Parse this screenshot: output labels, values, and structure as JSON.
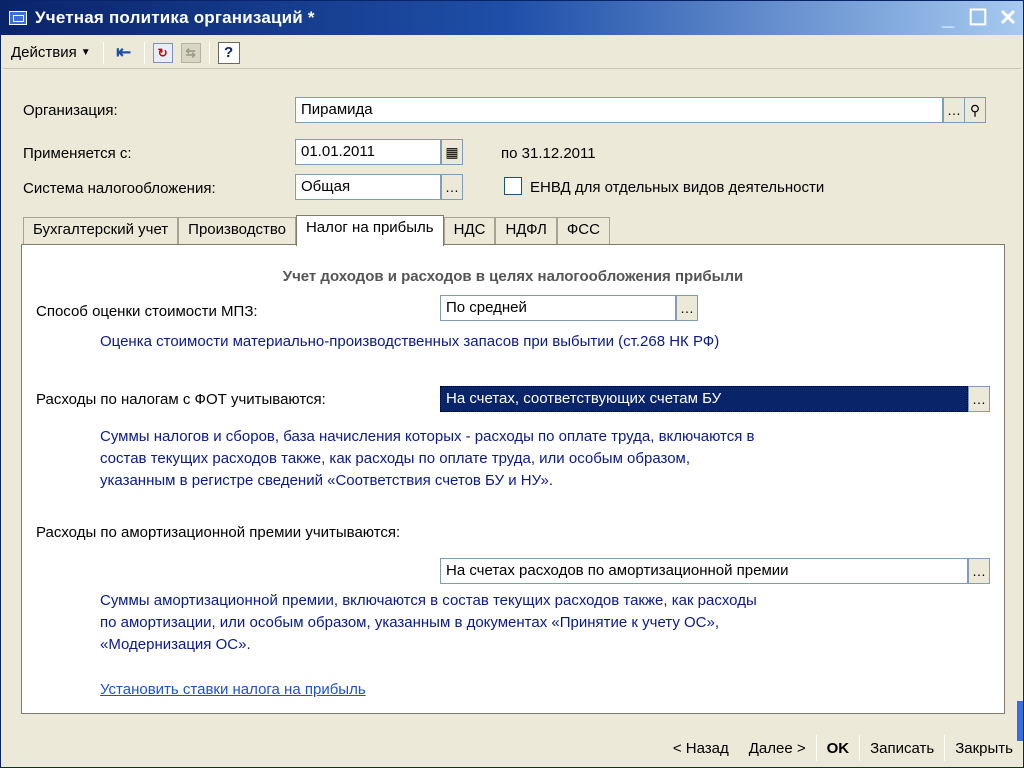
{
  "window": {
    "title": "Учетная политика организаций *",
    "controls": [
      "_",
      "☐",
      "✕"
    ]
  },
  "toolbar": {
    "actions_label": "Действия",
    "help_label": "?"
  },
  "form": {
    "organization_label": "Организация:",
    "organization_value": "Пирамида",
    "applies_from_label": "Применяется с:",
    "applies_from_value": "01.01.2011",
    "applies_to_text": "по 31.12.2011",
    "tax_system_label": "Система налогообложения:",
    "tax_system_value": "Общая",
    "envd_checkbox_label": "ЕНВД для отдельных видов деятельности",
    "envd_checked": false
  },
  "tabs": [
    {
      "label": "Бухгалтерский учет",
      "active": false
    },
    {
      "label": "Производство",
      "active": false
    },
    {
      "label": "Налог на прибыль",
      "active": true
    },
    {
      "label": "НДС",
      "active": false
    },
    {
      "label": "НДФЛ",
      "active": false
    },
    {
      "label": "ФСС",
      "active": false
    }
  ],
  "panel": {
    "section_title": "Учет доходов и расходов в целях налогообложения прибыли",
    "mpz_label": "Способ оценки стоимости МПЗ:",
    "mpz_value": "По средней",
    "mpz_desc": "Оценка стоимости материально-производственных запасов при выбытии (ст.268 НК РФ)",
    "fot_label": "Расходы по налогам с ФОТ учитываются:",
    "fot_value": "На счетах, соответствующих счетам БУ",
    "fot_desc_1": "Суммы налогов и сборов, база начисления которых - расходы по оплате труда, включаются в",
    "fot_desc_2": "состав текущих расходов также, как расходы по оплате труда, или особым образом,",
    "fot_desc_3": "указанным в регистре сведений «Соответствия счетов БУ и НУ».",
    "amort_label": "Расходы по амортизационной премии учитываются:",
    "amort_value": "На счетах расходов по амортизационной премии",
    "amort_desc_1": "Суммы амортизационной премии, включаются в состав текущих расходов также, как расходы",
    "amort_desc_2": "по амортизации, или особым образом, указанным в документах «Принятие к учету ОС»,",
    "amort_desc_3": "«Модернизация ОС».",
    "rates_link": "Установить ставки налога на прибыль"
  },
  "bottom": {
    "back_label": "< Назад",
    "next_label": "Далее >",
    "ok_label": "OK",
    "save_label": "Записать",
    "close_label": "Закрыть"
  }
}
